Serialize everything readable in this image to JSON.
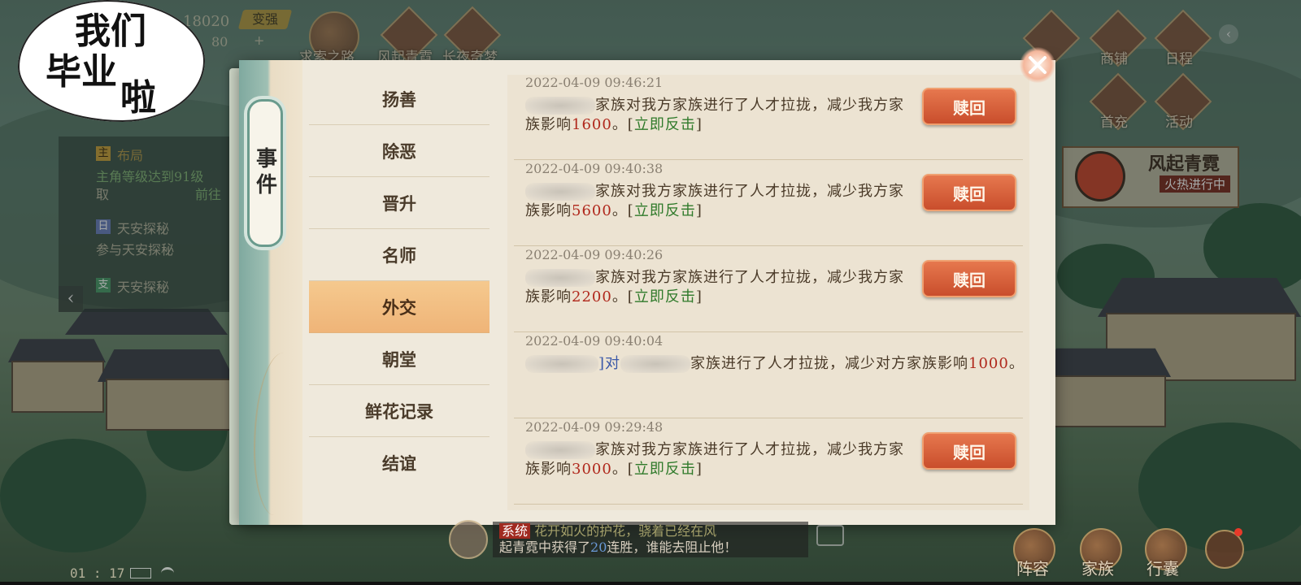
{
  "sticker": {
    "line1": "我们",
    "line2": "毕业",
    "line3": "啦"
  },
  "player": {
    "power": "18020",
    "upgrade": "变强",
    "energy": "80",
    "plus": "+"
  },
  "top_icons": [
    {
      "label": "求索之路",
      "icon": "scroll-icon"
    },
    {
      "label": "风起青霓",
      "icon": "emblem-icon"
    },
    {
      "label": "长夜奇梦",
      "icon": "flame-icon"
    }
  ],
  "right_icons": [
    {
      "label": "商铺",
      "icon": "shop-icon"
    },
    {
      "label": "日程",
      "icon": "calendar-icon"
    },
    {
      "label": "首充",
      "icon": "gift-icon"
    },
    {
      "label": "活动",
      "icon": "event-icon"
    }
  ],
  "banner": {
    "title": "风起青霓",
    "subtitle": "火热进行中"
  },
  "quest": {
    "tag1": "主",
    "title1": "布局",
    "desc1": "主角等级达到91级",
    "desc1b": "取",
    "goto": "前往",
    "tag2": "日",
    "title2": "天安探秘",
    "desc2": "参与天安探秘",
    "tag3": "支",
    "title3": "天安探秘"
  },
  "dialog": {
    "tab_title": "事件",
    "menu": [
      {
        "label": "扬善",
        "active": false
      },
      {
        "label": "除恶",
        "active": false
      },
      {
        "label": "晋升",
        "active": false
      },
      {
        "label": "名师",
        "active": false
      },
      {
        "label": "外交",
        "active": true
      },
      {
        "label": "朝堂",
        "active": false
      },
      {
        "label": "鲜花记录",
        "active": false
      },
      {
        "label": "结谊",
        "active": false
      }
    ],
    "entries": [
      {
        "timestamp": "2022-04-09 09:46:21",
        "text_a": "家族对我方家族进行了人才拉拢，减少我方家族影响",
        "value": "1600",
        "text_b": "。[",
        "link": "立即反击",
        "text_c": "]",
        "button": "赎回"
      },
      {
        "timestamp": "2022-04-09 09:40:38",
        "text_a": "家族对我方家族进行了人才拉拢，减少我方家族影响",
        "value": "5600",
        "text_b": "。[",
        "link": "立即反击",
        "text_c": "]",
        "button": "赎回"
      },
      {
        "timestamp": "2022-04-09 09:40:26",
        "text_a": "家族对我方家族进行了人才拉拢，减少我方家族影响",
        "value": "2200",
        "text_b": "。[",
        "link": "立即反击",
        "text_c": "]",
        "button": "赎回"
      },
      {
        "timestamp": "2022-04-09 09:40:04",
        "text_pre": "]对",
        "text_a": "家族进行了人才拉拢，减少对方家族影响",
        "value": "1000",
        "text_b": "。"
      },
      {
        "timestamp": "2022-04-09 09:29:48",
        "text_a": "家族对我方家族进行了人才拉拢，减少我方家族影响",
        "value": "3000",
        "text_b": "。[",
        "link": "立即反击",
        "text_c": "]",
        "button": "赎回"
      }
    ]
  },
  "chat": {
    "tag": "系统",
    "line1": "花开如火的护花，骁着已经在风",
    "line2a": "起青霓中获得了",
    "count": "20",
    "line2b": "连胜，谁能去阻止他！"
  },
  "bottom_icons": [
    {
      "label": "阵容",
      "icon": "lineup-icon"
    },
    {
      "label": "家族",
      "icon": "clan-icon"
    },
    {
      "label": "行囊",
      "icon": "bag-icon"
    }
  ],
  "status": {
    "time": "01 : 17"
  },
  "colors": {
    "accent": "#efb478",
    "button": "#d45f38",
    "value_red": "#b0281c",
    "link_green": "#2f7a2a"
  }
}
